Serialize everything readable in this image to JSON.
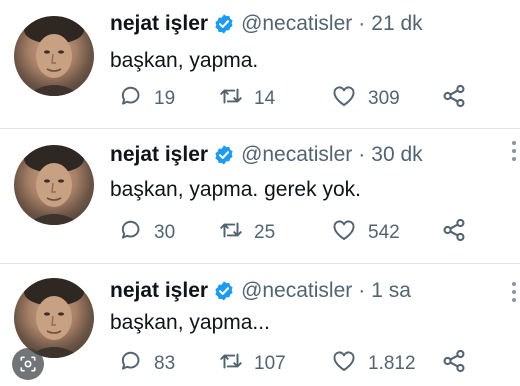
{
  "tweets": [
    {
      "author_name": "nejat işler",
      "handle": "@necatisler",
      "separator": "·",
      "time": "21 dk",
      "text": "başkan, yapma.",
      "replies": "19",
      "retweets": "14",
      "likes": "309"
    },
    {
      "author_name": "nejat işler",
      "handle": "@necatisler",
      "separator": "·",
      "time": "30 dk",
      "text": "başkan, yapma. gerek yok.",
      "replies": "30",
      "retweets": "25",
      "likes": "542"
    },
    {
      "author_name": "nejat işler",
      "handle": "@necatisler",
      "separator": "·",
      "time": "1 sa",
      "text": "başkan, yapma...",
      "replies": "83",
      "retweets": "107",
      "likes": "1.812"
    }
  ],
  "icons": {
    "verified": "verified-badge-icon",
    "reply": "reply-icon",
    "retweet": "retweet-icon",
    "like": "heart-icon",
    "share": "share-icon",
    "more": "more-icon",
    "lens": "image-search-icon"
  },
  "colors": {
    "verified": "#1d9bf0",
    "text": "#0f1419",
    "secondary": "#536471",
    "divider": "#dfe3e6"
  }
}
